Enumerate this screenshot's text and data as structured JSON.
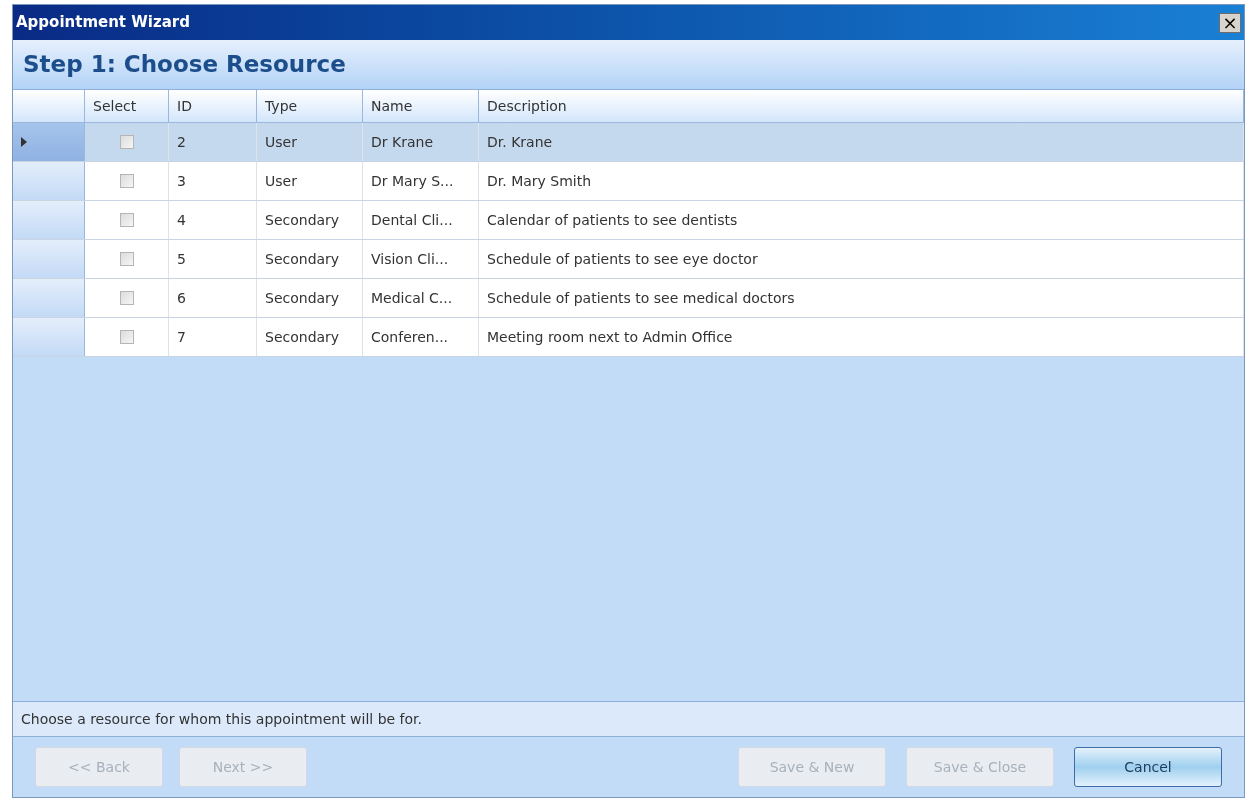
{
  "window": {
    "title": "Appointment Wizard",
    "close_label": "×"
  },
  "step_title": "Step 1: Choose Resource",
  "table": {
    "columns": [
      "Select",
      "ID",
      "Type",
      "Name",
      "Description"
    ],
    "rows": [
      {
        "selected": true,
        "checked": false,
        "id": "2",
        "type": "User",
        "name": "Dr Krane",
        "description": "Dr. Krane"
      },
      {
        "selected": false,
        "checked": false,
        "id": "3",
        "type": "User",
        "name": "Dr Mary S...",
        "description": "Dr. Mary Smith"
      },
      {
        "selected": false,
        "checked": false,
        "id": "4",
        "type": "Secondary",
        "name": "Dental Cli...",
        "description": "Calendar of patients to see dentists"
      },
      {
        "selected": false,
        "checked": false,
        "id": "5",
        "type": "Secondary",
        "name": "Vision Cli...",
        "description": "Schedule of patients to see eye doctor"
      },
      {
        "selected": false,
        "checked": false,
        "id": "6",
        "type": "Secondary",
        "name": "Medical C...",
        "description": "Schedule of patients to see medical doctors"
      },
      {
        "selected": false,
        "checked": false,
        "id": "7",
        "type": "Secondary",
        "name": "Conferen...",
        "description": "Meeting room next to Admin Office"
      }
    ]
  },
  "hint": "Choose a resource for whom this appointment will be for.",
  "buttons_left": [
    {
      "label": "<< Back",
      "disabled": true
    },
    {
      "label": "Next >>",
      "disabled": true
    }
  ],
  "buttons_right": [
    {
      "label": "Save & New",
      "disabled": true
    },
    {
      "label": "Save & Close",
      "disabled": true
    },
    {
      "label": "Cancel",
      "disabled": false
    }
  ]
}
